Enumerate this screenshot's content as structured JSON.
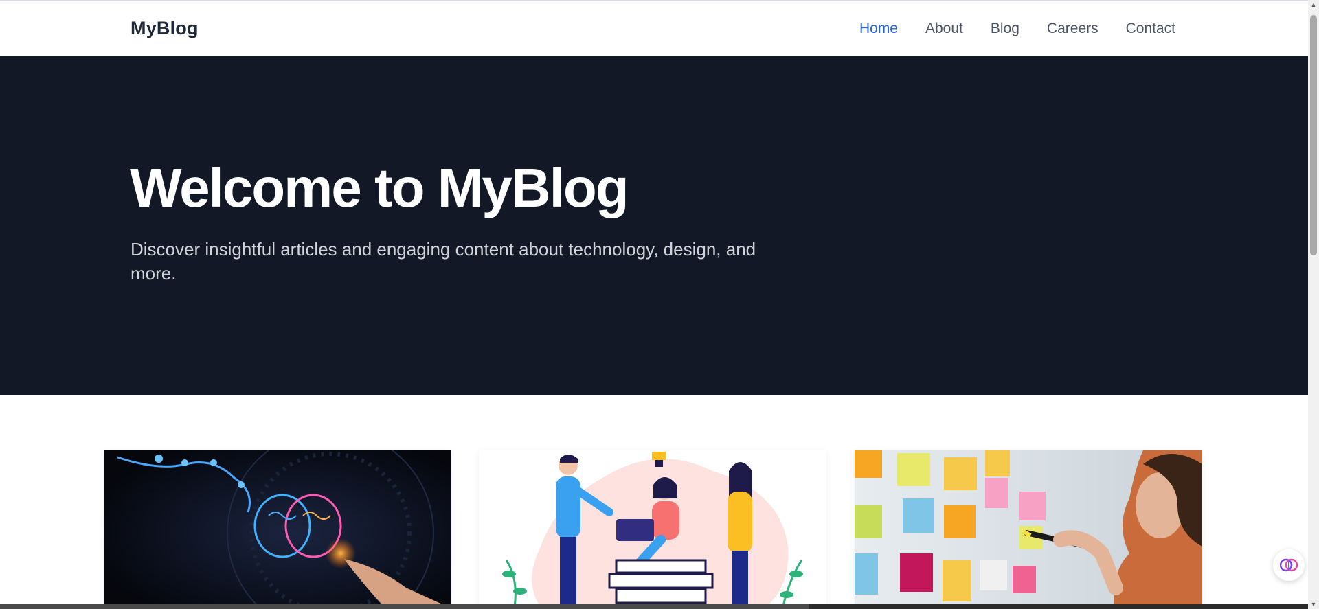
{
  "site": {
    "logo": "MyBlog"
  },
  "nav": {
    "items": [
      {
        "label": "Home",
        "active": true
      },
      {
        "label": "About",
        "active": false
      },
      {
        "label": "Blog",
        "active": false
      },
      {
        "label": "Careers",
        "active": false
      },
      {
        "label": "Contact",
        "active": false
      }
    ]
  },
  "hero": {
    "title": "Welcome to MyBlog",
    "subtitle": "Discover insightful articles and engaging content about technology, design, and more."
  },
  "cards": [
    {
      "image_icon": "ai-brain-illustration"
    },
    {
      "image_icon": "team-collaboration-illustration"
    },
    {
      "image_icon": "sticky-notes-brainstorm-photo"
    }
  ],
  "colors": {
    "accent": "#2563eb",
    "hero_bg": "#121826",
    "nav_text": "#4b5563",
    "logo_text": "#1f2937"
  }
}
